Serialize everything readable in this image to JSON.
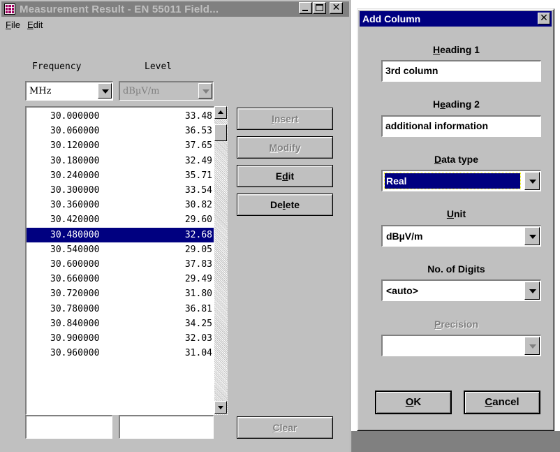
{
  "left_window": {
    "title": "Measurement Result - EN 55011 Field...",
    "menu": [
      {
        "label": "File",
        "key": "F",
        "rest": "ile"
      },
      {
        "label": "Edit",
        "key": "E",
        "rest": "dit"
      }
    ],
    "headers": {
      "frequency": "Frequency",
      "level": "Level"
    },
    "freq_unit": "MHz",
    "level_unit": "dBµV/m",
    "rows": [
      {
        "freq": "30.000000",
        "level": "33.48"
      },
      {
        "freq": "30.060000",
        "level": "36.53"
      },
      {
        "freq": "30.120000",
        "level": "37.65"
      },
      {
        "freq": "30.180000",
        "level": "32.49"
      },
      {
        "freq": "30.240000",
        "level": "35.71"
      },
      {
        "freq": "30.300000",
        "level": "33.54"
      },
      {
        "freq": "30.360000",
        "level": "30.82"
      },
      {
        "freq": "30.420000",
        "level": "29.60"
      },
      {
        "freq": "30.480000",
        "level": "32.68"
      },
      {
        "freq": "30.540000",
        "level": "29.05"
      },
      {
        "freq": "30.600000",
        "level": "37.83"
      },
      {
        "freq": "30.660000",
        "level": "29.49"
      },
      {
        "freq": "30.720000",
        "level": "31.80"
      },
      {
        "freq": "30.780000",
        "level": "36.81"
      },
      {
        "freq": "30.840000",
        "level": "34.25"
      },
      {
        "freq": "30.900000",
        "level": "32.03"
      },
      {
        "freq": "30.960000",
        "level": "31.04"
      }
    ],
    "buttons": {
      "insert": {
        "key": "I",
        "rest": "nsert"
      },
      "modify": {
        "key": "M",
        "rest": "odify"
      },
      "edit": {
        "pre": "E",
        "key": "d",
        "rest": "it"
      },
      "delete": {
        "pre": "De",
        "key": "l",
        "rest": "ete"
      },
      "clear": {
        "key": "C",
        "rest": "lear"
      }
    }
  },
  "dialog": {
    "title": "Add Column",
    "heading1": {
      "key": "H",
      "rest": "eading 1",
      "value": "3rd column"
    },
    "heading2": {
      "pre": "H",
      "key": "e",
      "rest": "ading 2",
      "value": "additional information"
    },
    "data_type": {
      "key": "D",
      "rest": "ata type",
      "value": "Real"
    },
    "unit": {
      "key": "U",
      "rest": "nit",
      "value": "dBµV/m"
    },
    "digits": {
      "label": "No. of Digits",
      "value": "<auto>"
    },
    "precision": {
      "key": "P",
      "rest": "recision",
      "value": ""
    },
    "ok": {
      "key": "O",
      "rest": "K"
    },
    "cancel": {
      "key": "C",
      "rest": "ancel"
    }
  }
}
